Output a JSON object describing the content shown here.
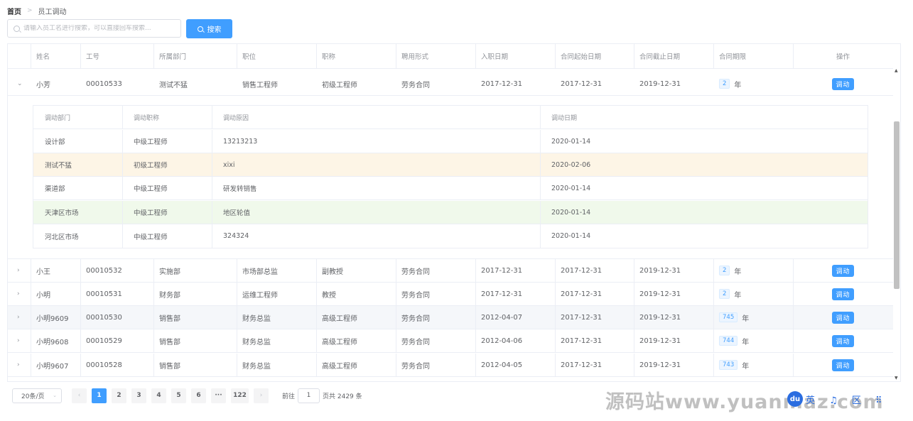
{
  "breadcrumb": {
    "home": "首页",
    "current": "员工调动"
  },
  "search": {
    "placeholder": "请输入员工名进行搜索，可以直接回车搜索...",
    "button_label": "搜索"
  },
  "table": {
    "headers": [
      "姓名",
      "工号",
      "所属部门",
      "职位",
      "职称",
      "聘用形式",
      "入职日期",
      "合同起始日期",
      "合同截止日期",
      "合同期限",
      "操作"
    ],
    "year_unit": "年",
    "action_label": "调动",
    "rows": [
      {
        "name": "小芳",
        "id": "00010533",
        "dept": "测试不猛",
        "position": "销售工程师",
        "title": "初级工程师",
        "hire_type": "劳务合同",
        "join_date": "2017-12-31",
        "start": "2017-12-31",
        "end": "2019-12-31",
        "term": "2",
        "expanded": true
      },
      {
        "name": "小王",
        "id": "00010532",
        "dept": "实施部",
        "position": "市场部总监",
        "title": "副教授",
        "hire_type": "劳务合同",
        "join_date": "2017-12-31",
        "start": "2017-12-31",
        "end": "2019-12-31",
        "term": "2"
      },
      {
        "name": "小明",
        "id": "00010531",
        "dept": "财务部",
        "position": "运维工程师",
        "title": "教授",
        "hire_type": "劳务合同",
        "join_date": "2017-12-31",
        "start": "2017-12-31",
        "end": "2019-12-31",
        "term": "2"
      },
      {
        "name": "小明9609",
        "id": "00010530",
        "dept": "销售部",
        "position": "财务总监",
        "title": "高级工程师",
        "hire_type": "劳务合同",
        "join_date": "2012-04-07",
        "start": "2017-12-31",
        "end": "2019-12-31",
        "term": "745"
      },
      {
        "name": "小明9608",
        "id": "00010529",
        "dept": "销售部",
        "position": "财务总监",
        "title": "高级工程师",
        "hire_type": "劳务合同",
        "join_date": "2012-04-06",
        "start": "2017-12-31",
        "end": "2019-12-31",
        "term": "744"
      },
      {
        "name": "小明9607",
        "id": "00010528",
        "dept": "销售部",
        "position": "财务总监",
        "title": "高级工程师",
        "hire_type": "劳务合同",
        "join_date": "2012-04-05",
        "start": "2017-12-31",
        "end": "2019-12-31",
        "term": "743"
      }
    ]
  },
  "transfer": {
    "headers": [
      "调动部门",
      "调动职称",
      "调动原因",
      "调动日期"
    ],
    "rows": [
      {
        "dept": "设计部",
        "title": "中级工程师",
        "reason": "13213213",
        "date": "2020-01-14"
      },
      {
        "dept": "测试不猛",
        "title": "初级工程师",
        "reason": "xixi",
        "date": "2020-02-06"
      },
      {
        "dept": "渠道部",
        "title": "中级工程师",
        "reason": "研发转销售",
        "date": "2020-01-14"
      },
      {
        "dept": "天津区市场",
        "title": "中级工程师",
        "reason": "地区轮值",
        "date": "2020-01-14"
      },
      {
        "dept": "河北区市场",
        "title": "中级工程师",
        "reason": "324324",
        "date": "2020-01-14"
      }
    ]
  },
  "pagination": {
    "page_size": "20条/页",
    "pages": [
      "1",
      "2",
      "3",
      "4",
      "5",
      "6",
      "···",
      "122"
    ],
    "current_page": "1",
    "goto_label": "前往",
    "goto_value": "1",
    "total_label": "页共 2429 条"
  },
  "watermark": "源码站www.yuanmaz.com",
  "overlay": {
    "du_label": "du",
    "tools": "英 ♫ 区 ⠿"
  }
}
